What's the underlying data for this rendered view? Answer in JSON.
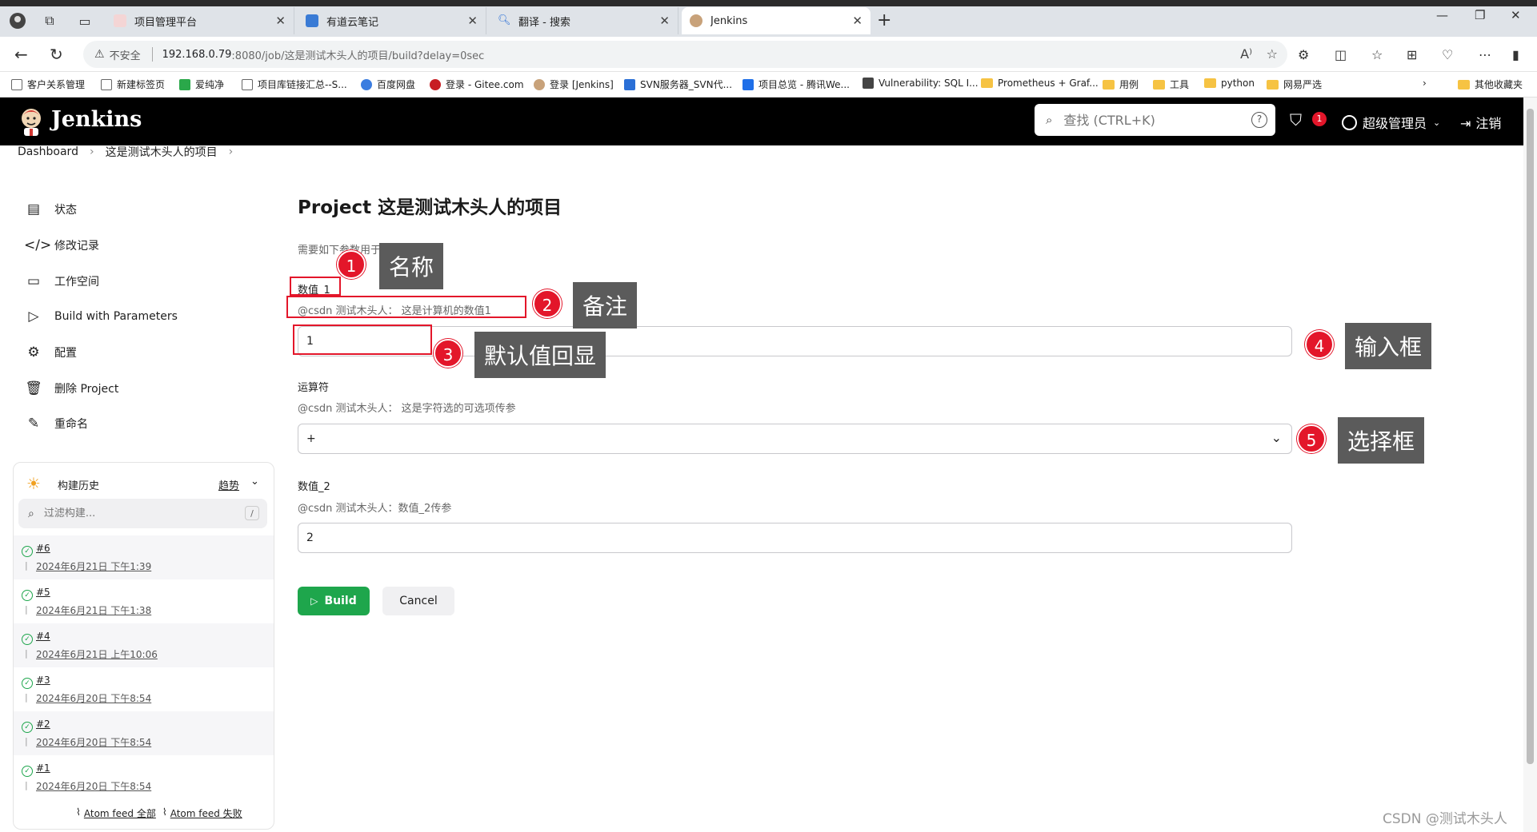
{
  "browser": {
    "tabs": [
      {
        "title": "项目管理平台",
        "fav_color": "#f4d5d5"
      },
      {
        "title": "有道云笔记",
        "fav_color": "#3a7bd5"
      },
      {
        "title": "翻译 - 搜索",
        "fav_color": "#2b6fd6"
      },
      {
        "title": "Jenkins",
        "fav_color": "#c8a27a"
      }
    ],
    "active_tab": 3,
    "address": {
      "security": "不安全",
      "host": "192.168.0.79",
      "path": ":8080/job/这是测试木头人的项目/build?delay=0sec"
    },
    "bookmarks": [
      "客户关系管理",
      "新建标签页",
      "爱纯净",
      "项目库链接汇总--S...",
      "百度网盘",
      "登录 - Gitee.com",
      "登录 [Jenkins]",
      "SVN服务器_SVN代...",
      "项目总览 - 腾讯We...",
      "Vulnerability: SQL I...",
      "Prometheus + Graf...",
      "用例",
      "工具",
      "python",
      "网易严选"
    ],
    "other_bookmarks": "其他收藏夹"
  },
  "jenkins": {
    "title": "Jenkins",
    "search_placeholder": "查找 (CTRL+K)",
    "alerts": "1",
    "user": "超级管理员",
    "logout": "注销"
  },
  "breadcrumb": [
    "Dashboard",
    "这是测试木头人的项目"
  ],
  "sidebar": {
    "items": [
      {
        "label": "状态",
        "icon": "document-icon"
      },
      {
        "label": "修改记录",
        "icon": "code-icon"
      },
      {
        "label": "工作空间",
        "icon": "folder-icon"
      },
      {
        "label": "Build with Parameters",
        "icon": "play-icon"
      },
      {
        "label": "配置",
        "icon": "gear-icon"
      },
      {
        "label": "删除 Project",
        "icon": "trash-icon"
      },
      {
        "label": "重命名",
        "icon": "pencil-icon"
      }
    ],
    "history": {
      "title": "构建历史",
      "trend": "趋势",
      "filter_placeholder": "过滤构建...",
      "builds": [
        {
          "num": "#6",
          "date": "2024年6月21日 下午1:39"
        },
        {
          "num": "#5",
          "date": "2024年6月21日 下午1:38"
        },
        {
          "num": "#4",
          "date": "2024年6月21日 上午10:06"
        },
        {
          "num": "#3",
          "date": "2024年6月20日 下午8:54"
        },
        {
          "num": "#2",
          "date": "2024年6月20日 下午8:54"
        },
        {
          "num": "#1",
          "date": "2024年6月20日 下午8:54"
        }
      ],
      "feed_all": "Atom feed 全部",
      "feed_fail": "Atom feed 失败"
    }
  },
  "main": {
    "title": "Project 这是测试木头人的项目",
    "intro": "需要如下参数用于构建项目:",
    "params": [
      {
        "name": "数值_1",
        "desc": "@csdn 测试木头人： 这是计算机的数值1",
        "value": "1"
      },
      {
        "name": "运算符",
        "desc": "@csdn 测试木头人： 这是字符选的可选项传参",
        "value": "+"
      },
      {
        "name": "数值_2",
        "desc": "@csdn 测试木头人：数值_2传参",
        "value": "2"
      }
    ],
    "build_label": "Build",
    "cancel_label": "Cancel"
  },
  "annotations": [
    {
      "n": "1",
      "text": "名称"
    },
    {
      "n": "2",
      "text": "备注"
    },
    {
      "n": "3",
      "text": "默认值回显"
    },
    {
      "n": "4",
      "text": "输入框"
    },
    {
      "n": "5",
      "text": "选择框"
    }
  ],
  "watermark": "CSDN @测试木头人"
}
